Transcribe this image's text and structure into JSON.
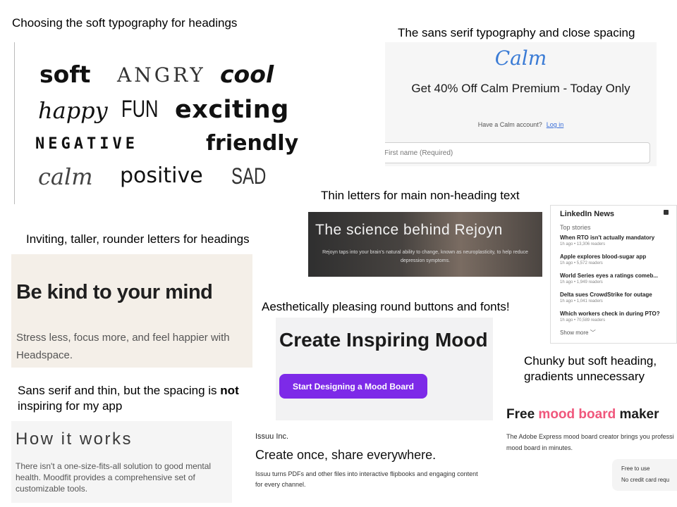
{
  "captions": {
    "soft_typography": "Choosing the soft typography for headings",
    "sans_serif_close": "The sans serif typography and close spacing",
    "thin_letters": "Thin letters for main non-heading text",
    "inviting_taller": "Inviting, taller, rounder letters for headings",
    "round_buttons": "Aesthetically pleasing round buttons and fonts!",
    "chunky_line1": "Chunky but soft heading,",
    "chunky_line2": "gradients unnecessary",
    "not_inspiring_pre": "Sans serif and thin, but the spacing is ",
    "not_inspiring_bold": "not",
    "not_inspiring_line2": "inspiring for my app"
  },
  "font_samples": {
    "soft": "soft",
    "angry": "ANGRY",
    "cool": "cool",
    "happy": "happy",
    "fun": "FUN",
    "exciting": "exciting",
    "negative": "NEGATIVE",
    "friendly": "friendly",
    "calm": "calm",
    "positive": "positive",
    "sad": "SAD"
  },
  "calm": {
    "logo": "Calm",
    "headline": "Get 40% Off Calm Premium - Today Only",
    "account_prompt": "Have a Calm account?",
    "login_link": "Log in",
    "first_name_placeholder": "First name (Required)"
  },
  "rejoyn": {
    "title": "The science behind Rejoyn",
    "body": "Rejoyn taps into your brain's natural ability to change, known as neuroplasticity, to help reduce depression symptoms."
  },
  "linkedin": {
    "title": "LinkedIn News",
    "subtitle": "Top stories",
    "items": [
      {
        "title": "When RTO isn't actually mandatory",
        "meta": "1h ago • 13,306 readers"
      },
      {
        "title": "Apple explores blood-sugar app",
        "meta": "1h ago • 5,572 readers"
      },
      {
        "title": "World Series eyes a ratings comeb...",
        "meta": "1h ago • 1,949 readers"
      },
      {
        "title": "Delta sues CrowdStrike for outage",
        "meta": "1h ago • 1,041 readers"
      },
      {
        "title": "Which workers check in during PTO?",
        "meta": "1h ago • 70,589 readers"
      }
    ],
    "show_more": "Show more"
  },
  "headspace": {
    "title": "Be kind to your mind",
    "body": "Stress less, focus more, and feel happier with Headspace."
  },
  "canva": {
    "title": "Create Inspiring Mood",
    "button": "Start Designing a Mood Board"
  },
  "adobe": {
    "title_pre": "Free ",
    "title_accent": "mood board",
    "title_post": " maker",
    "body_line1": "The Adobe Express mood board creator brings you professi",
    "body_line2": "mood board in minutes.",
    "badge_line1": "Free to use",
    "badge_line2": "No credit card requ"
  },
  "moodfit": {
    "title": "How it works",
    "body": "There isn't a one-size-fits-all solution to good mental health. Moodfit provides a comprehensive set of customizable tools."
  },
  "issuu": {
    "company": "Issuu Inc.",
    "title": "Create once, share everywhere.",
    "body": "Issuu turns PDFs and other files into interactive flipbooks and engaging content for every channel."
  },
  "colors": {
    "calm_blue": "#3a7bd5",
    "canva_purple": "#7d2ae8",
    "adobe_pink": "#f0577c",
    "headspace_bg": "#f4efe8"
  }
}
